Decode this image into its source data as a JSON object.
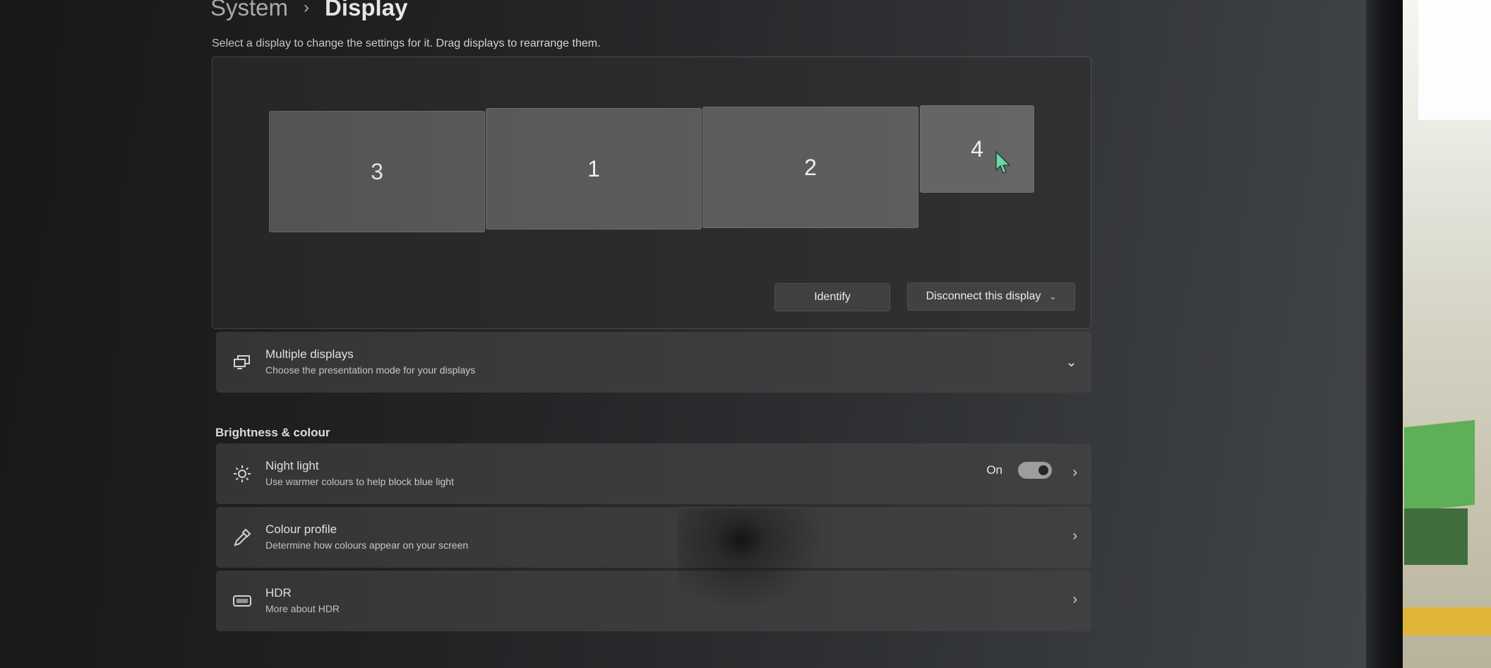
{
  "breadcrumb": {
    "parent": "System",
    "separator": "›",
    "current": "Display"
  },
  "instruction": "Select a display to change the settings for it. Drag displays to rearrange them.",
  "arrangement": {
    "monitors": [
      {
        "label": "3"
      },
      {
        "label": "1"
      },
      {
        "label": "2"
      },
      {
        "label": "4",
        "selected": true
      }
    ],
    "identify_label": "Identify",
    "disconnect_label": "Disconnect this display"
  },
  "multiple_displays": {
    "title": "Multiple displays",
    "subtitle": "Choose the presentation mode for your displays",
    "icon": "multiple-displays-icon"
  },
  "brightness_section": {
    "heading": "Brightness & colour",
    "night_light": {
      "title": "Night light",
      "subtitle": "Use warmer colours to help block blue light",
      "state_label": "On",
      "toggle_on": true,
      "icon": "sun-icon"
    },
    "colour_profile": {
      "title": "Colour profile",
      "subtitle": "Determine how colours appear on your screen",
      "icon": "eyedropper-icon"
    },
    "hdr": {
      "title": "HDR",
      "subtitle": "More about HDR",
      "icon": "hdr-icon"
    }
  },
  "colors": {
    "accent_cursor": "#6fd3a5",
    "card_bg": "#3a3a3b",
    "monitor_bg": "#5a5a5a"
  }
}
